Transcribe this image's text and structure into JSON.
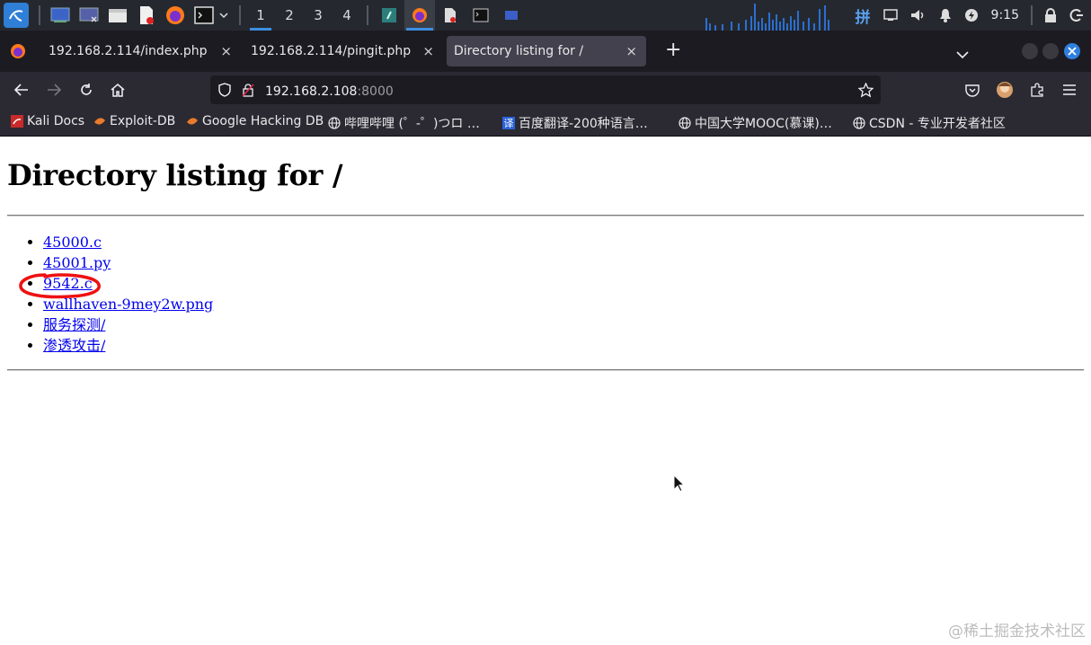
{
  "taskbar": {
    "workspaces": [
      "1",
      "2",
      "3",
      "4"
    ],
    "active_workspace": "1",
    "apps": [
      "kali-menu-icon",
      "desktop-icon",
      "terminal-window-icon",
      "file-manager-icon",
      "text-editor-icon",
      "firefox-icon",
      "terminal-icon"
    ],
    "clock": "9:15"
  },
  "tabs": [
    {
      "label": "192.168.2.114/index.php",
      "active": false
    },
    {
      "label": "192.168.2.114/pingit.php",
      "active": false
    },
    {
      "label": "Directory listing for /",
      "active": true
    }
  ],
  "tab_close_symbol": "×",
  "new_tab_symbol": "+",
  "url": {
    "host": "192.168.2.108",
    "port": ":8000"
  },
  "bookmarks": [
    {
      "label": "Kali Docs",
      "icon": "kali-docs-icon"
    },
    {
      "label": "Exploit-DB",
      "icon": "exploit-db-icon"
    },
    {
      "label": "Google Hacking DB",
      "icon": "ghdb-icon"
    },
    {
      "label": "哔哩哔哩 (゜-゜)つロ …",
      "icon": "globe-icon"
    },
    {
      "label": "百度翻译-200种语言…",
      "icon": "baidu-translate-icon"
    },
    {
      "label": "中国大学MOOC(慕课)…",
      "icon": "globe-icon"
    },
    {
      "label": "CSDN - 专业开发者社区",
      "icon": "globe-icon"
    }
  ],
  "page": {
    "heading": "Directory listing for /",
    "files": [
      "45000.c",
      "45001.py",
      "9542.c",
      "wallhaven-9mey2w.png",
      "服务探测/",
      "渗透攻击/"
    ]
  },
  "watermark": "@稀土掘金技术社区",
  "colors": {
    "link": "#0000ee",
    "accent": "#3d8ee0",
    "annotation": "#ee1111"
  }
}
